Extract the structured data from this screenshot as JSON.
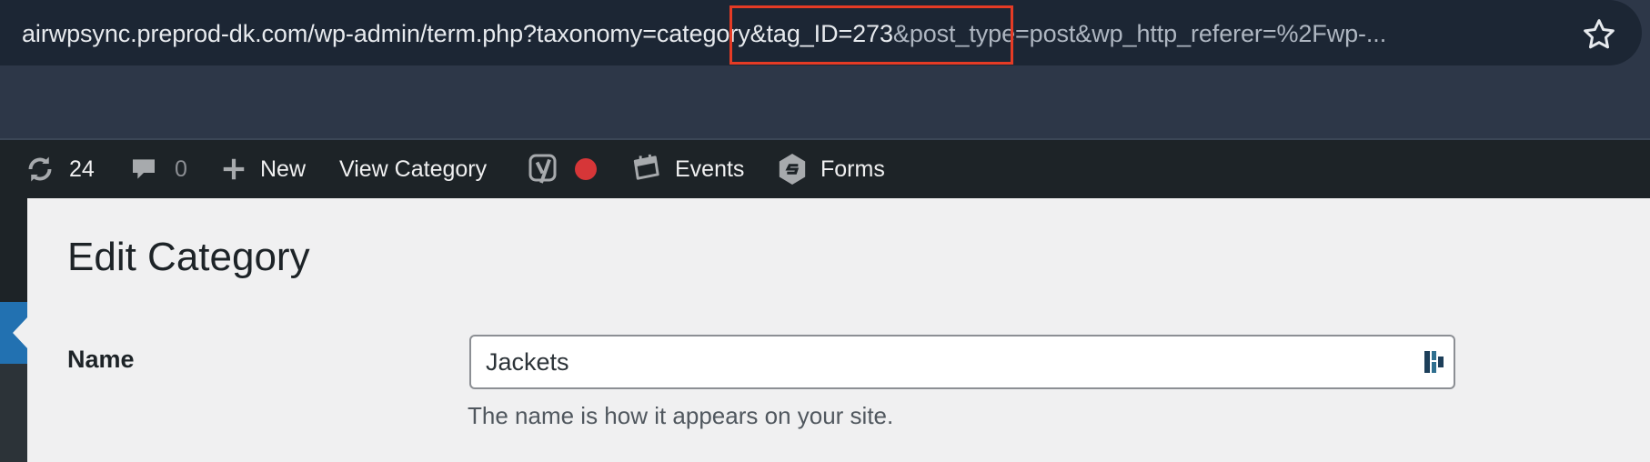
{
  "browser": {
    "url_highlighted_prefix_pre": "airwpsync.preprod-dk.com/wp-admin/term.php?taxonomy=",
    "url_highlighted": "category&tag_ID=273",
    "url_post": "&post_type=post&wp_http_referer=%2Fwp-...",
    "highlight_color": "#e53b25"
  },
  "admin_bar": {
    "updates_count": "24",
    "comments_count": "0",
    "new_label": "New",
    "view_label": "View Category",
    "events_label": "Events",
    "forms_label": "Forms",
    "icons": [
      "updates-icon",
      "comments-icon",
      "plus-icon",
      "yoast-icon",
      "notification-dot",
      "events-icon",
      "forms-icon"
    ]
  },
  "page": {
    "title": "Edit Category",
    "name_label": "Name",
    "name_value": "Jackets",
    "name_help": "The name is how it appears on your site."
  },
  "colors": {
    "admin_bar": "#1d2327",
    "accent": "#2271b1",
    "notification": "#d63638",
    "content_bg": "#f0f0f1"
  }
}
